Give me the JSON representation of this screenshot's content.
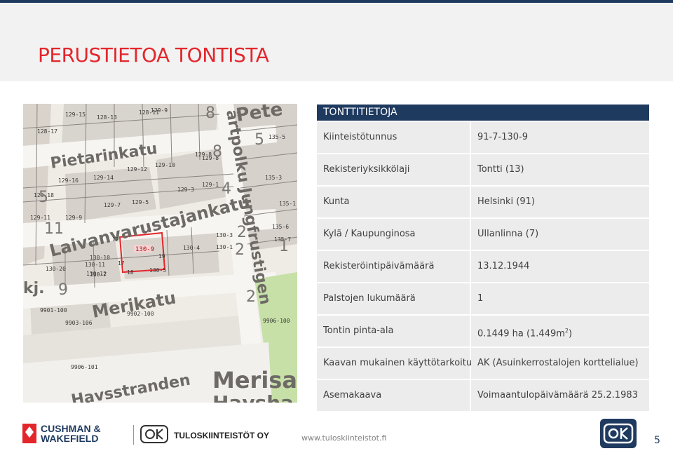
{
  "header": {
    "title": "PERUSTIETOA TONTISTA"
  },
  "map": {
    "streets": [
      "Pietarinkatu",
      "Laivanvarustajankatu",
      "Merikatu",
      "Merisa",
      "Havsha",
      "Havsstranden",
      "Pete",
      "kj."
    ],
    "vertical_street": "ärtpolku Jungfrustigen",
    "lots": [
      "129-9",
      "129-15",
      "128-13",
      "128-11",
      "129-8",
      "135-5",
      "128-17",
      "129-16",
      "129-14",
      "129-12",
      "129-10",
      "129-8",
      "135-3",
      "129-18",
      "129-3",
      "129-1",
      "129-7",
      "129-5",
      "135-1",
      "129-11",
      "129-9",
      "130-3",
      "135-6",
      "130-1",
      "135-7",
      "130-4",
      "130-10",
      "130-11",
      "130-12",
      "130-5",
      "130-7",
      "130-20",
      "9901-100",
      "9902-100",
      "9903-106",
      "9906-100",
      "9906-101",
      "12",
      "17",
      "18",
      "19"
    ],
    "highlighted_lot": "130-9",
    "block_numbers": [
      "8",
      "8",
      "5",
      "11",
      "4",
      "2",
      "5",
      "9",
      "2",
      "2",
      "1"
    ]
  },
  "info_table": {
    "heading": "TONTTITIETOJA",
    "rows": [
      {
        "label": "Kiinteistötunnus",
        "value": "91-7-130-9"
      },
      {
        "label": "Rekisteriyksikkölaji",
        "value": "Tontti (13)"
      },
      {
        "label": "Kunta",
        "value": "Helsinki (91)"
      },
      {
        "label": "Kylä / Kaupunginosa",
        "value": "Ullanlinna (7)"
      },
      {
        "label": "Rekisteröintipäivämäärä",
        "value": "13.12.1944"
      },
      {
        "label": "Palstojen lukumäärä",
        "value": "1"
      },
      {
        "label": "Tontin pinta-ala",
        "value_main": "0.1449 ha (1.449m",
        "value_sup": "2",
        "value_end": ")"
      },
      {
        "label": "Kaavan mukainen käyttötarkoitus",
        "value": "AK (Asuinkerrostalojen korttelialue)"
      },
      {
        "label": "Asemakaava",
        "value": "Voimaantulopäivämäärä 25.2.1983"
      }
    ]
  },
  "footer": {
    "logo1": "CUSHMAN & WAKEFIELD",
    "logo1_line1": "CUSHMAN &",
    "logo1_line2": "WAKEFIELD",
    "logo2": "TULOSKIINTEISTÖT OY",
    "website": "www.tuloskiinteistot.fi",
    "page_number": "5"
  },
  "colors": {
    "title_red": "#e3262b",
    "navy": "#1f3a5f",
    "row_gray": "#ececec"
  }
}
